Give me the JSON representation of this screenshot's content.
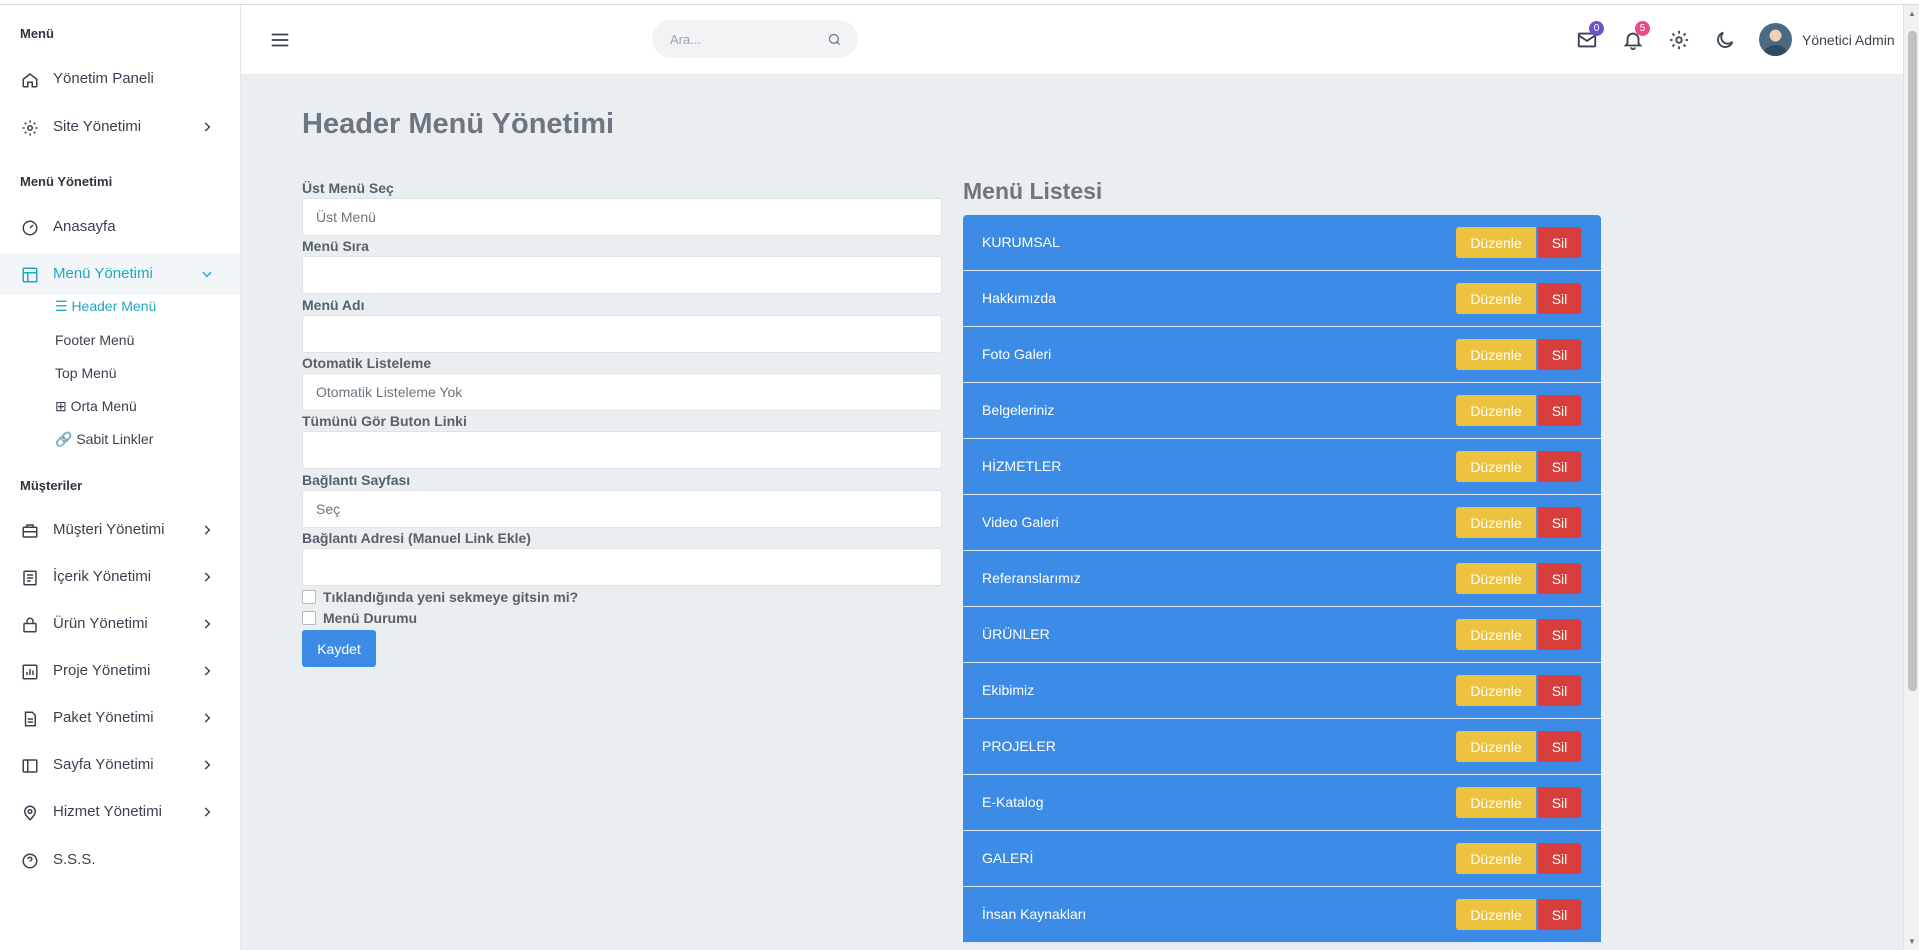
{
  "sidebar": {
    "section_menu": "Menü",
    "dashboard": "Yönetim Paneli",
    "site_management": "Site Yönetimi",
    "section_menu_management": "Menü Yönetimi",
    "homepage": "Anasayfa",
    "menu_management": "Menü Yönetimi",
    "sub_items": [
      "☰ Header Menü",
      "Footer Menü",
      "Top Menü",
      "⊞ Orta Menü",
      "🔗 Sabit Linkler"
    ],
    "section_customers": "Müşteriler",
    "customer_items": [
      "Müşteri Yönetimi",
      "İçerik Yönetimi",
      "Ürün Yönetimi",
      "Proje Yönetimi",
      "Paket Yönetimi",
      "Sayfa Yönetimi",
      "Hizmet Yönetimi"
    ],
    "faq": "S.S.S."
  },
  "topbar": {
    "search_placeholder": "Ara...",
    "mail_count": "0",
    "notif_count": "5",
    "user_name": "Yönetici Admin",
    "colors": {
      "mail_badge": "#6f52c9",
      "notif_badge": "#e84a8a"
    }
  },
  "page": {
    "title": "Header Menü Yönetimi"
  },
  "form": {
    "parent_label": "Üst Menü Seç",
    "parent_value": "Üst Menü",
    "order_label": "Menü Sıra",
    "order_value": "",
    "name_label": "Menü Adı",
    "name_value": "",
    "autolist_label": "Otomatik Listeleme",
    "autolist_value": "Otomatik Listeleme Yok",
    "seeall_label": "Tümünü Gör Buton Linki",
    "seeall_value": "",
    "linkpage_label": "Bağlantı Sayfası",
    "linkpage_value": "Seç",
    "linkaddr_label": "Bağlantı Adresi (Manuel Link Ekle)",
    "linkaddr_value": "",
    "newtab_label": "Tıklandığında yeni sekmeye gitsin mi?",
    "status_label": "Menü Durumu",
    "save_label": "Kaydet"
  },
  "menu_list": {
    "title": "Menü Listesi",
    "edit_label": "Düzenle",
    "delete_label": "Sil",
    "items": [
      "KURUMSAL",
      "Hakkımızda",
      "Foto Galeri",
      "Belgeleriniz",
      "HİZMETLER",
      "Video Galeri",
      "Referanslarımız",
      "ÜRÜNLER",
      "Ekibimiz",
      "PROJELER",
      "E-Katalog",
      "GALERİ",
      "İnsan Kaynakları"
    ]
  }
}
